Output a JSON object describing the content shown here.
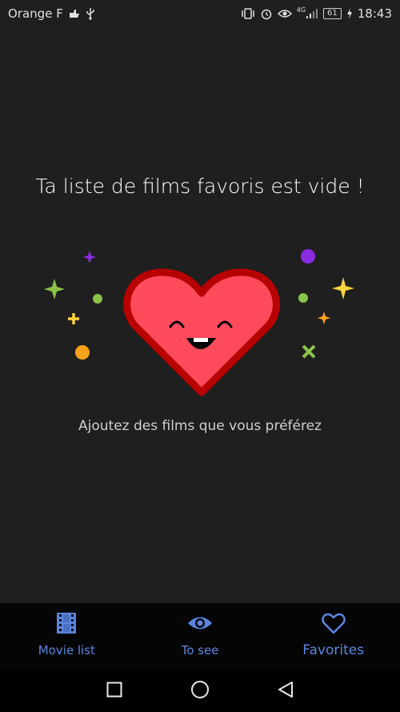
{
  "status_bar": {
    "carrier": "Orange F",
    "network": "4G",
    "battery": "61",
    "time": "18:43"
  },
  "empty_state": {
    "title": "Ta liste de films favoris est vide !",
    "subtitle": "Ajoutez des films que vous préférez",
    "heart_color": "#ff4b5c",
    "heart_outline_color": "#b80000"
  },
  "bottom_nav": {
    "items": [
      {
        "label": "Movie list",
        "icon": "film-strip-icon"
      },
      {
        "label": "To see",
        "icon": "eye-icon"
      },
      {
        "label": "Favorites",
        "icon": "heart-outline-icon",
        "active": true
      }
    ],
    "accent": "#5a86e0"
  },
  "system_nav": {
    "buttons": [
      "recents-square-icon",
      "home-circle-icon",
      "back-triangle-icon"
    ]
  }
}
